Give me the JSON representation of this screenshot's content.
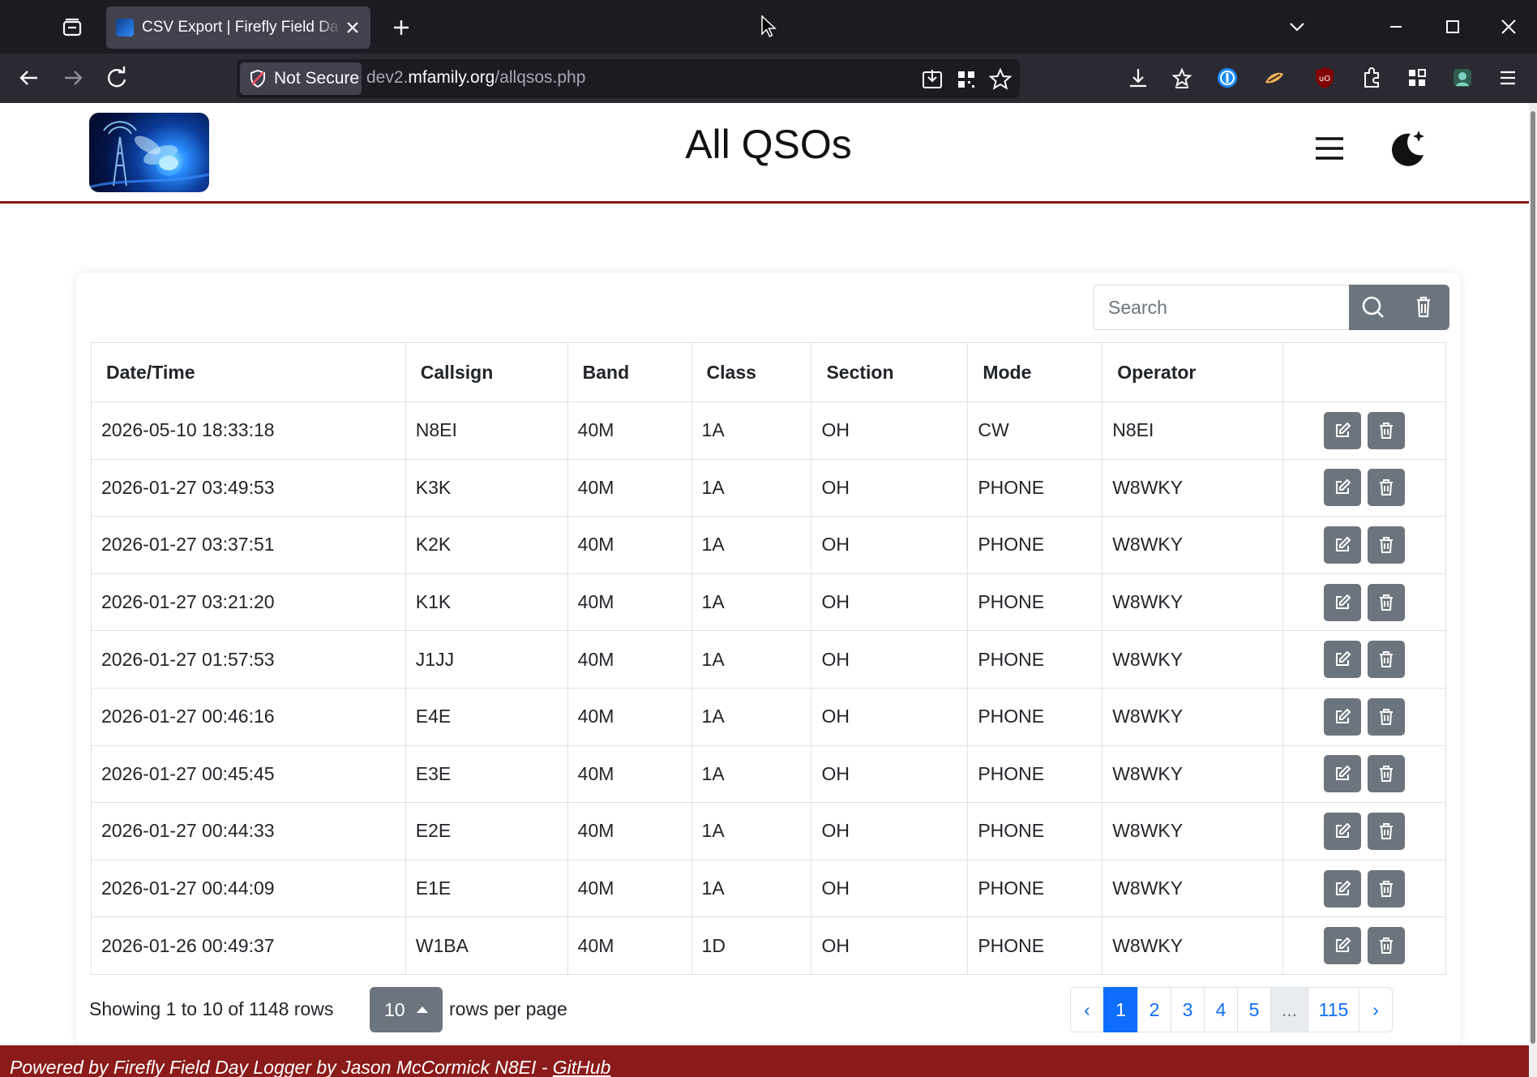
{
  "browser": {
    "tab_title": "CSV Export | Firefly Field Day Logger",
    "security_label": "Not Secure",
    "url_prefix": "dev2.",
    "url_host": "mfamily.org",
    "url_path": "/allqsos.php"
  },
  "header": {
    "title": "All QSOs"
  },
  "search": {
    "placeholder": "Search"
  },
  "table": {
    "columns": [
      "Date/Time",
      "Callsign",
      "Band",
      "Class",
      "Section",
      "Mode",
      "Operator",
      ""
    ],
    "rows": [
      [
        "2026-05-10 18:33:18",
        "N8EI",
        "40M",
        "1A",
        "OH",
        "CW",
        "N8EI"
      ],
      [
        "2026-01-27 03:49:53",
        "K3K",
        "40M",
        "1A",
        "OH",
        "PHONE",
        "W8WKY"
      ],
      [
        "2026-01-27 03:37:51",
        "K2K",
        "40M",
        "1A",
        "OH",
        "PHONE",
        "W8WKY"
      ],
      [
        "2026-01-27 03:21:20",
        "K1K",
        "40M",
        "1A",
        "OH",
        "PHONE",
        "W8WKY"
      ],
      [
        "2026-01-27 01:57:53",
        "J1JJ",
        "40M",
        "1A",
        "OH",
        "PHONE",
        "W8WKY"
      ],
      [
        "2026-01-27 00:46:16",
        "E4E",
        "40M",
        "1A",
        "OH",
        "PHONE",
        "W8WKY"
      ],
      [
        "2026-01-27 00:45:45",
        "E3E",
        "40M",
        "1A",
        "OH",
        "PHONE",
        "W8WKY"
      ],
      [
        "2026-01-27 00:44:33",
        "E2E",
        "40M",
        "1A",
        "OH",
        "PHONE",
        "W8WKY"
      ],
      [
        "2026-01-27 00:44:09",
        "E1E",
        "40M",
        "1A",
        "OH",
        "PHONE",
        "W8WKY"
      ],
      [
        "2026-01-26 00:49:37",
        "W1BA",
        "40M",
        "1D",
        "OH",
        "PHONE",
        "W8WKY"
      ]
    ]
  },
  "pager": {
    "showing": "Showing 1 to 10 of 1148 rows",
    "page_size": "10",
    "rows_per_page": "rows per page",
    "prev": "‹",
    "pages": [
      "1",
      "2",
      "3",
      "4",
      "5"
    ],
    "ellipsis": "...",
    "last_page": "115",
    "next": "›",
    "active_page": "1"
  },
  "footer": {
    "text": "Powered by Firefly Field Day Logger by Jason McCormick N8EI - ",
    "link": "GitHub"
  },
  "colors": {
    "accent_red": "#8b1a1a",
    "button_gray": "#6c757d",
    "primary_blue": "#0d6efd"
  },
  "icons": [
    "tab-list-icon",
    "favicon-icon",
    "close-icon",
    "plus-icon",
    "chevron-down-icon",
    "minimize-icon",
    "maximize-icon",
    "back-icon",
    "forward-icon",
    "reload-icon",
    "shield-icon",
    "install-icon",
    "qr-icon",
    "bookmark-star-icon",
    "download-icon",
    "bookmarks-icon",
    "password-manager-icon",
    "extension-icon",
    "ublock-icon",
    "puzzle-icon",
    "grid-icon",
    "profile-icon",
    "hamburger-icon",
    "moon-icon",
    "search-icon",
    "trash-icon",
    "edit-icon"
  ]
}
